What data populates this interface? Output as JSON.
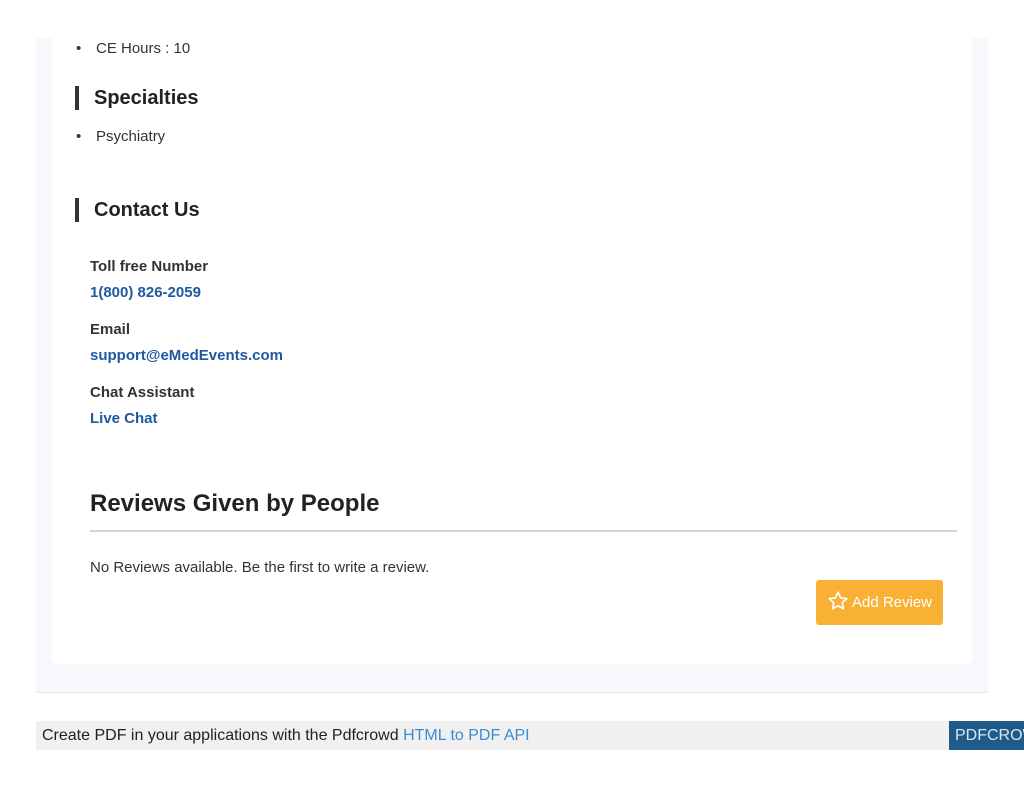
{
  "details": {
    "ce_hours": "CE Hours : 10"
  },
  "specialties": {
    "heading": "Specialties",
    "items": [
      "Psychiatry"
    ]
  },
  "contact": {
    "heading": "Contact Us",
    "toll_free_label": "Toll free Number",
    "toll_free_value": "1(800) 826-2059",
    "email_label": "Email",
    "email_value": "support@eMedEvents.com",
    "chat_label": "Chat Assistant",
    "chat_value": "Live Chat"
  },
  "reviews": {
    "title": "Reviews Given by People",
    "empty_message": "No Reviews available. Be the first to write a review.",
    "add_button_label": "Add Review",
    "button_color": "#f8b134"
  },
  "pdf_banner": {
    "text": "Create PDF in your applications with the Pdfcrowd",
    "link_text": "HTML to PDF API",
    "brand": "PDFCROWD"
  }
}
